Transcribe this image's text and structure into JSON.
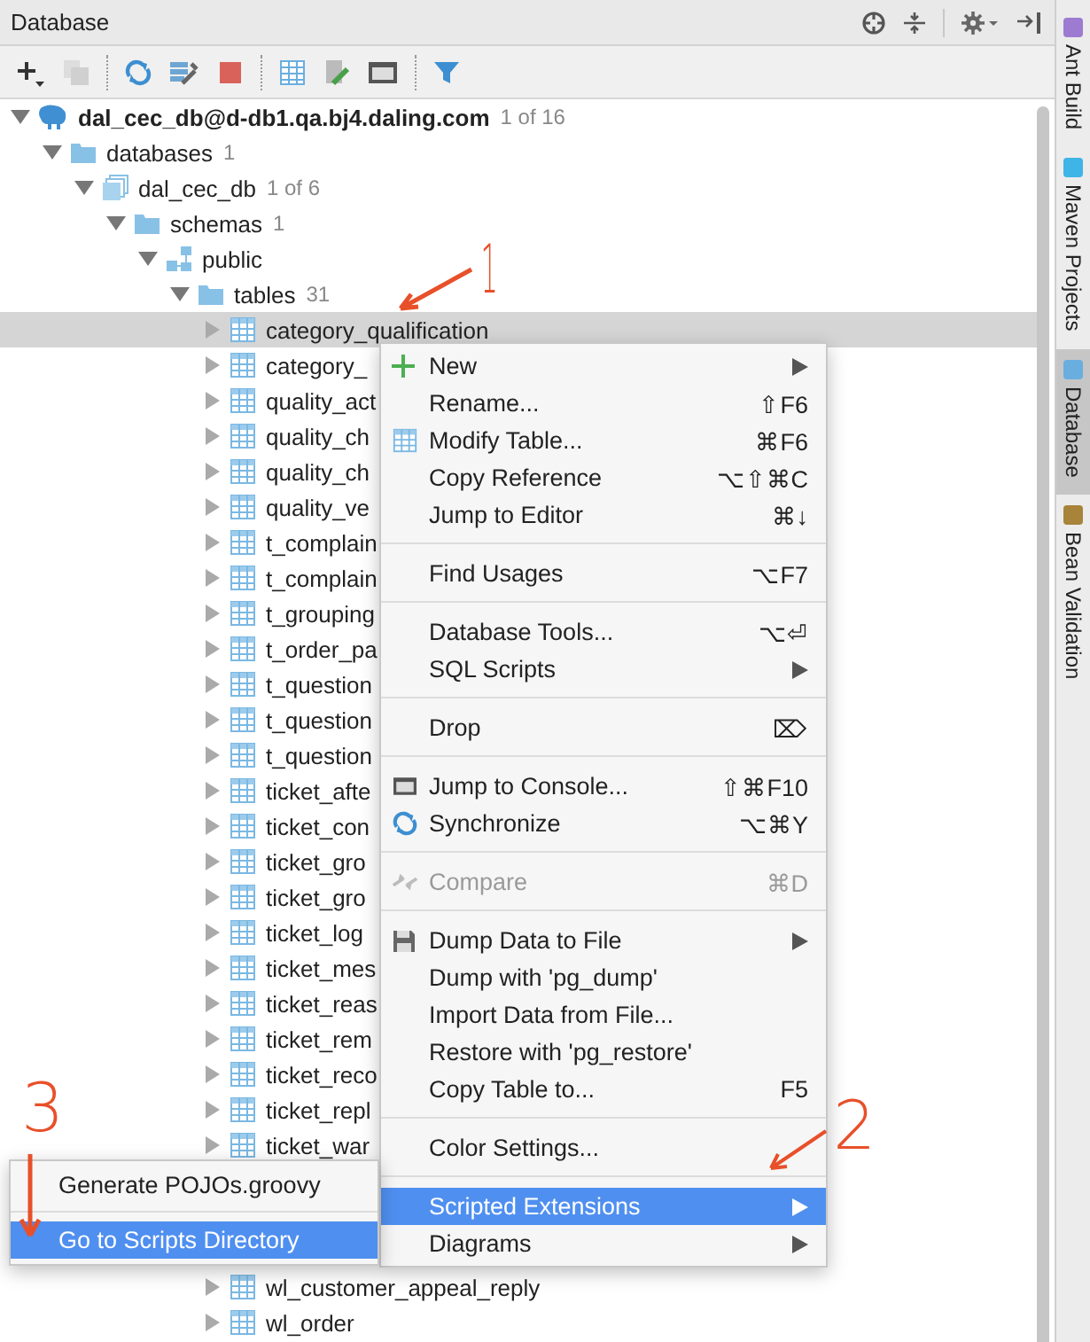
{
  "panel": {
    "title": "Database"
  },
  "tree": [
    {
      "kind": "datasource",
      "label": "dal_cec_db@d-db1.qa.bj4.daling.com",
      "count": "1 of 16",
      "expanded": true,
      "selected": false,
      "children": [
        {
          "kind": "folder",
          "label": "databases",
          "count": "1",
          "expanded": true,
          "selected": false,
          "children": [
            {
              "kind": "database",
              "label": "dal_cec_db",
              "count": "1 of 6",
              "expanded": true,
              "selected": false,
              "children": [
                {
                  "kind": "folder",
                  "label": "schemas",
                  "count": "1",
                  "expanded": true,
                  "selected": false,
                  "children": [
                    {
                      "kind": "schema",
                      "label": "public",
                      "expanded": true,
                      "selected": false,
                      "children": [
                        {
                          "kind": "folder",
                          "label": "tables",
                          "count": "31",
                          "expanded": true,
                          "selected": false,
                          "children": [
                            {
                              "kind": "table",
                              "label": "category_qualification",
                              "expanded": false,
                              "selected": true
                            },
                            {
                              "kind": "table",
                              "label": "category_",
                              "expanded": false,
                              "selected": false
                            },
                            {
                              "kind": "table",
                              "label": "quality_act",
                              "expanded": false,
                              "selected": false
                            },
                            {
                              "kind": "table",
                              "label": "quality_ch",
                              "expanded": false,
                              "selected": false
                            },
                            {
                              "kind": "table",
                              "label": "quality_ch",
                              "expanded": false,
                              "selected": false
                            },
                            {
                              "kind": "table",
                              "label": "quality_ve",
                              "expanded": false,
                              "selected": false
                            },
                            {
                              "kind": "table",
                              "label": "t_complain",
                              "expanded": false,
                              "selected": false
                            },
                            {
                              "kind": "table",
                              "label": "t_complain",
                              "expanded": false,
                              "selected": false
                            },
                            {
                              "kind": "table",
                              "label": "t_grouping",
                              "expanded": false,
                              "selected": false
                            },
                            {
                              "kind": "table",
                              "label": "t_order_pa",
                              "expanded": false,
                              "selected": false
                            },
                            {
                              "kind": "table",
                              "label": "t_question",
                              "expanded": false,
                              "selected": false
                            },
                            {
                              "kind": "table",
                              "label": "t_question",
                              "expanded": false,
                              "selected": false
                            },
                            {
                              "kind": "table",
                              "label": "t_question",
                              "expanded": false,
                              "selected": false
                            },
                            {
                              "kind": "table",
                              "label": "ticket_afte",
                              "expanded": false,
                              "selected": false
                            },
                            {
                              "kind": "table",
                              "label": "ticket_con",
                              "expanded": false,
                              "selected": false
                            },
                            {
                              "kind": "table",
                              "label": "ticket_gro",
                              "expanded": false,
                              "selected": false
                            },
                            {
                              "kind": "table",
                              "label": "ticket_gro",
                              "expanded": false,
                              "selected": false
                            },
                            {
                              "kind": "table",
                              "label": "ticket_log",
                              "expanded": false,
                              "selected": false
                            },
                            {
                              "kind": "table",
                              "label": "ticket_mes",
                              "expanded": false,
                              "selected": false
                            },
                            {
                              "kind": "table",
                              "label": "ticket_reas",
                              "expanded": false,
                              "selected": false
                            },
                            {
                              "kind": "table",
                              "label": "ticket_rem",
                              "expanded": false,
                              "selected": false
                            },
                            {
                              "kind": "table",
                              "label": "ticket_reco",
                              "expanded": false,
                              "selected": false
                            },
                            {
                              "kind": "table",
                              "label": "ticket_repl",
                              "expanded": false,
                              "selected": false
                            },
                            {
                              "kind": "table",
                              "label": "ticket_war",
                              "expanded": false,
                              "selected": false
                            },
                            {
                              "kind": "hidden"
                            },
                            {
                              "kind": "hidden"
                            },
                            {
                              "kind": "hidden"
                            },
                            {
                              "kind": "table",
                              "label": "wl_customer_appeal_reply",
                              "expanded": false,
                              "selected": false
                            },
                            {
                              "kind": "table",
                              "label": "wl_order",
                              "expanded": false,
                              "selected": false
                            }
                          ]
                        }
                      ]
                    }
                  ]
                }
              ]
            }
          ]
        }
      ]
    }
  ],
  "context_menu": [
    [
      {
        "label": "New",
        "submenu": true,
        "disabled": false,
        "selected": false
      },
      {
        "label": "Rename...",
        "shortcut": "⇧F6",
        "disabled": false,
        "selected": false
      },
      {
        "label": "Modify Table...",
        "shortcut": "⌘F6",
        "disabled": false,
        "selected": false
      },
      {
        "label": "Copy Reference",
        "shortcut": "⌥⇧⌘C",
        "disabled": false,
        "selected": false
      },
      {
        "label": "Jump to Editor",
        "shortcut": "⌘↓",
        "disabled": false,
        "selected": false
      }
    ],
    [
      {
        "label": "Find Usages",
        "shortcut": "⌥F7",
        "disabled": false,
        "selected": false
      }
    ],
    [
      {
        "label": "Database Tools...",
        "shortcut": "⌥⏎",
        "disabled": false,
        "selected": false
      },
      {
        "label": "SQL Scripts",
        "submenu": true,
        "disabled": false,
        "selected": false
      }
    ],
    [
      {
        "label": "Drop",
        "shortcut": "⌦",
        "disabled": false,
        "selected": false
      }
    ],
    [
      {
        "label": "Jump to Console...",
        "shortcut": "⇧⌘F10",
        "disabled": false,
        "selected": false
      },
      {
        "label": "Synchronize",
        "shortcut": "⌥⌘Y",
        "disabled": false,
        "selected": false
      }
    ],
    [
      {
        "label": "Compare",
        "shortcut": "⌘D",
        "disabled": true,
        "selected": false
      }
    ],
    [
      {
        "label": "Dump Data to File",
        "submenu": true,
        "disabled": false,
        "selected": false
      },
      {
        "label": "Dump with 'pg_dump'",
        "disabled": false,
        "selected": false
      },
      {
        "label": "Import Data from File...",
        "disabled": false,
        "selected": false
      },
      {
        "label": "Restore with 'pg_restore'",
        "disabled": false,
        "selected": false
      },
      {
        "label": "Copy Table to...",
        "shortcut": "F5",
        "disabled": false,
        "selected": false
      }
    ],
    [
      {
        "label": "Color Settings...",
        "disabled": false,
        "selected": false
      }
    ],
    [
      {
        "label": "Scripted Extensions",
        "submenu": true,
        "disabled": false,
        "selected": true
      },
      {
        "label": "Diagrams",
        "submenu": true,
        "disabled": false,
        "selected": false
      }
    ]
  ],
  "submenu": [
    [
      {
        "label": "Generate POJOs.groovy",
        "selected": false
      }
    ],
    [
      {
        "label": "Go to Scripts Directory",
        "selected": true
      }
    ]
  ],
  "side_tabs": [
    {
      "label": "Ant Build",
      "selected": false
    },
    {
      "label": "Maven Projects",
      "selected": false
    },
    {
      "label": "Database",
      "selected": true
    },
    {
      "label": "Bean Validation",
      "selected": false
    }
  ],
  "annotations": [
    "1",
    "2",
    "3"
  ]
}
